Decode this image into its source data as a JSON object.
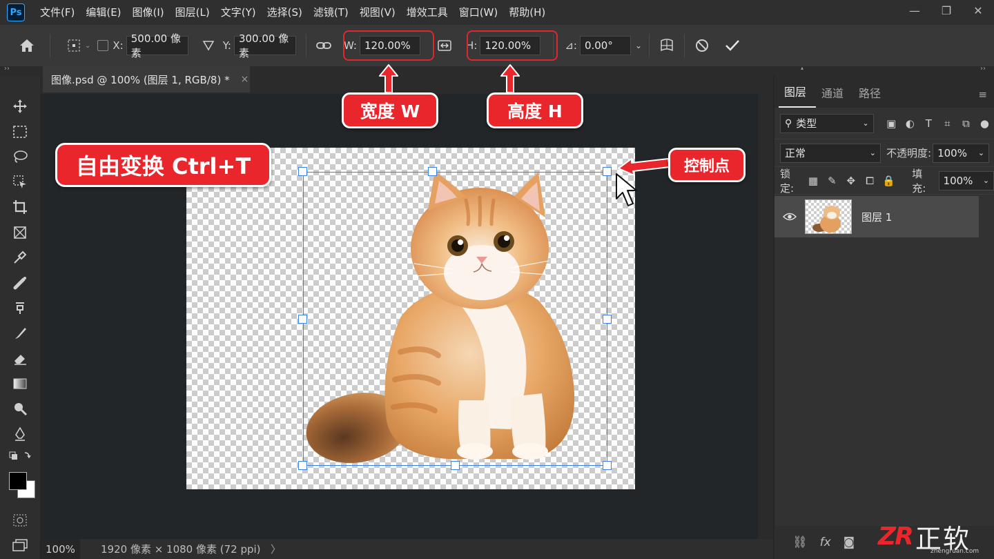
{
  "app": {
    "logo": "Ps"
  },
  "menu": [
    "文件(F)",
    "编辑(E)",
    "图像(I)",
    "图层(L)",
    "文字(Y)",
    "选择(S)",
    "滤镜(T)",
    "视图(V)",
    "增效工具",
    "窗口(W)",
    "帮助(H)"
  ],
  "window_controls": {
    "minimize": "—",
    "restore": "❐",
    "close": "✕"
  },
  "options": {
    "x_label": "X:",
    "x_value": "500.00 像素",
    "y_label": "Y:",
    "y_value": "300.00 像素",
    "w_label": "W:",
    "w_value": "120.00%",
    "h_label": "H:",
    "h_value": "120.00%",
    "angle_label": "⊿:",
    "angle_value": "0.00°"
  },
  "doc_tab": {
    "title": "图像.psd @ 100% (图层 1, RGB/8) *",
    "close": "×"
  },
  "status": {
    "zoom": "100%",
    "doc_info": "1920 像素 × 1080 像素 (72 ppi)",
    "arrow": "〉"
  },
  "panels": {
    "tabs": [
      "图层",
      "通道",
      "路径"
    ],
    "filter_kind": "类型",
    "blend_mode": "正常",
    "opacity_label": "不透明度:",
    "opacity_value": "100%",
    "lock_label": "锁定:",
    "fill_label": "填充:",
    "fill_value": "100%",
    "layer_name": "图层 1"
  },
  "annotations": {
    "width_label": "宽度 W",
    "height_label": "高度 H",
    "free_transform": "自由变换 Ctrl+T",
    "control_point": "控制点"
  },
  "watermark": {
    "logo": "ZR",
    "text": "正软",
    "url": "zhengruan.com"
  },
  "colors": {
    "accent_red": "#e8262b",
    "transform_blue": "#3b82e6",
    "ps_blue": "#31a8ff"
  }
}
